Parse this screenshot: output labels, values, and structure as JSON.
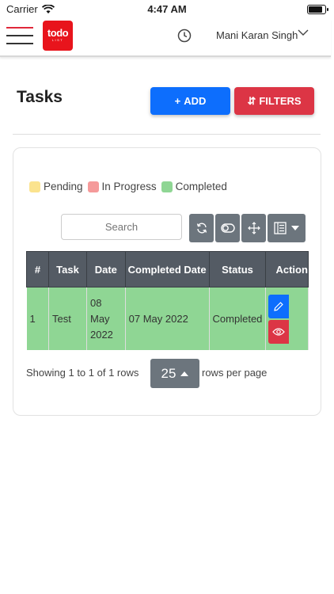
{
  "status_bar": {
    "carrier": "Carrier",
    "time": "4:47 AM",
    "battery_level": 0.95
  },
  "header": {
    "logo": {
      "main": "todo",
      "sub": "LIST"
    },
    "user_name": "Mani Karan Singh"
  },
  "page": {
    "title": "Tasks",
    "add_label": "ADD",
    "filters_label": "FILTERS"
  },
  "legend": [
    {
      "label": "Pending",
      "color": "#fbe38e"
    },
    {
      "label": "In Progress",
      "color": "#f59a9a"
    },
    {
      "label": "Completed",
      "color": "#8fd694"
    }
  ],
  "search": {
    "placeholder": "Search"
  },
  "table": {
    "columns": [
      "#",
      "Task",
      "Date",
      "Completed Date",
      "Status",
      "Action"
    ],
    "rows": [
      {
        "num": "1",
        "task": "Test",
        "date": "08 May 2022",
        "completed_date": "07 May 2022",
        "status": "Completed"
      }
    ]
  },
  "pagination": {
    "showing": "Showing 1 to 1 of 1 rows",
    "page_size": "25",
    "rows_per_page": "rows per page"
  },
  "colors": {
    "primary": "#0d6efd",
    "danger": "#dc3545",
    "secondary": "#6c757d",
    "completed_row": "#8fd694",
    "table_header": "#545b64"
  }
}
